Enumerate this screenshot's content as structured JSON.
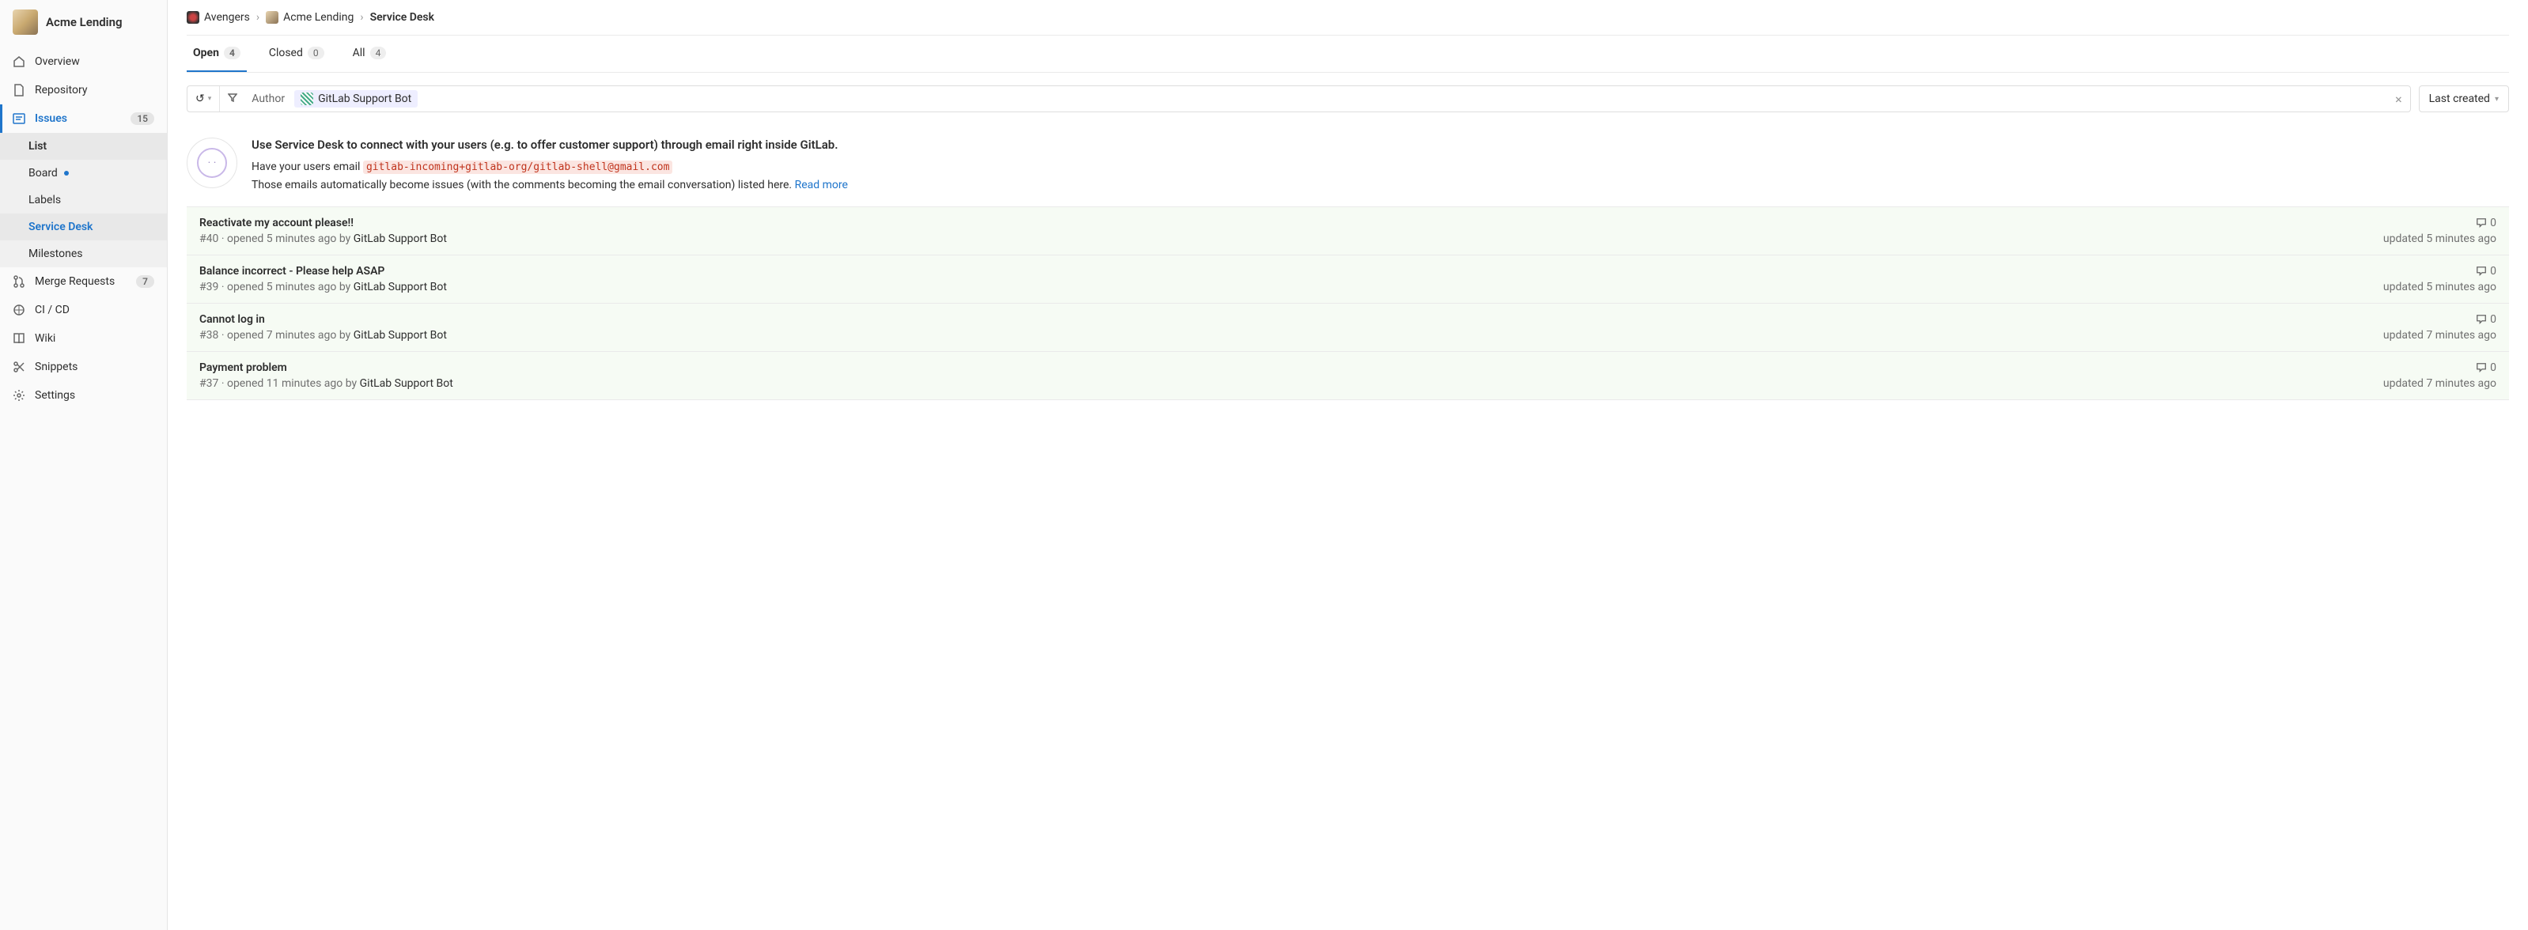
{
  "project": {
    "name": "Acme Lending"
  },
  "sidebar": {
    "items": [
      {
        "label": "Overview",
        "icon": "home"
      },
      {
        "label": "Repository",
        "icon": "file"
      },
      {
        "label": "Issues",
        "icon": "issues",
        "badge": "15",
        "active": true
      },
      {
        "label": "Merge Requests",
        "icon": "merge",
        "badge": "7"
      },
      {
        "label": "CI / CD",
        "icon": "rocket"
      },
      {
        "label": "Wiki",
        "icon": "book"
      },
      {
        "label": "Snippets",
        "icon": "scissors"
      },
      {
        "label": "Settings",
        "icon": "gear"
      }
    ],
    "sub": [
      {
        "label": "List"
      },
      {
        "label": "Board",
        "dot": true
      },
      {
        "label": "Labels"
      },
      {
        "label": "Service Desk",
        "active": true
      },
      {
        "label": "Milestones"
      }
    ]
  },
  "breadcrumbs": [
    {
      "label": "Avengers"
    },
    {
      "label": "Acme Lending"
    },
    {
      "label": "Service Desk"
    }
  ],
  "tabs": [
    {
      "label": "Open",
      "count": "4",
      "active": true
    },
    {
      "label": "Closed",
      "count": "0"
    },
    {
      "label": "All",
      "count": "4"
    }
  ],
  "filter": {
    "author_label": "Author",
    "chip": "GitLab Support Bot"
  },
  "sort": {
    "label": "Last created"
  },
  "info": {
    "heading": "Use Service Desk to connect with your users (e.g. to offer customer support) through email right inside GitLab.",
    "line2_prefix": "Have your users email ",
    "email": "gitlab-incoming+gitlab-org/gitlab-shell@gmail.com",
    "line3_prefix": "Those emails automatically become issues (with the comments becoming the email conversation) listed here. ",
    "read_more": "Read more"
  },
  "issues": [
    {
      "title": "Reactivate my account please!!",
      "id": "#40",
      "opened": "opened 5 minutes ago by",
      "author": "GitLab Support Bot",
      "comments": "0",
      "updated": "updated 5 minutes ago"
    },
    {
      "title": "Balance incorrect - Please help ASAP",
      "id": "#39",
      "opened": "opened 5 minutes ago by",
      "author": "GitLab Support Bot",
      "comments": "0",
      "updated": "updated 5 minutes ago"
    },
    {
      "title": "Cannot log in",
      "id": "#38",
      "opened": "opened 7 minutes ago by",
      "author": "GitLab Support Bot",
      "comments": "0",
      "updated": "updated 7 minutes ago"
    },
    {
      "title": "Payment problem",
      "id": "#37",
      "opened": "opened 11 minutes ago by",
      "author": "GitLab Support Bot",
      "comments": "0",
      "updated": "updated 7 minutes ago"
    }
  ]
}
